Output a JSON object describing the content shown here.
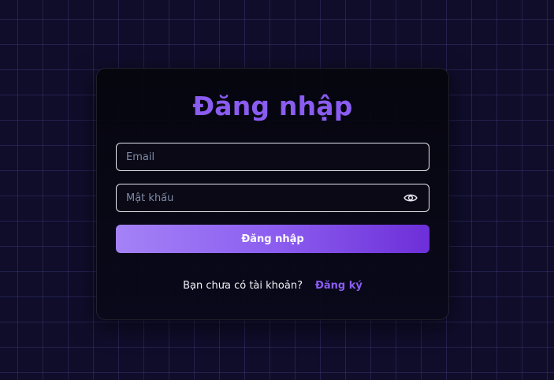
{
  "login_form": {
    "title": "Đăng nhập",
    "email": {
      "value": "",
      "placeholder": "Email"
    },
    "password": {
      "value": "",
      "placeholder": "Mật khẩu",
      "toggle_icon": "eye-icon"
    },
    "submit_label": "Đăng nhập",
    "signup_prompt": "Bạn chưa có tài khoản?",
    "signup_link": "Đăng ký"
  },
  "colors": {
    "background": "#0f0d2a",
    "accent": "#8a5cf0",
    "button_gradient_start": "#a482f6",
    "button_gradient_end": "#6d2fd8"
  }
}
